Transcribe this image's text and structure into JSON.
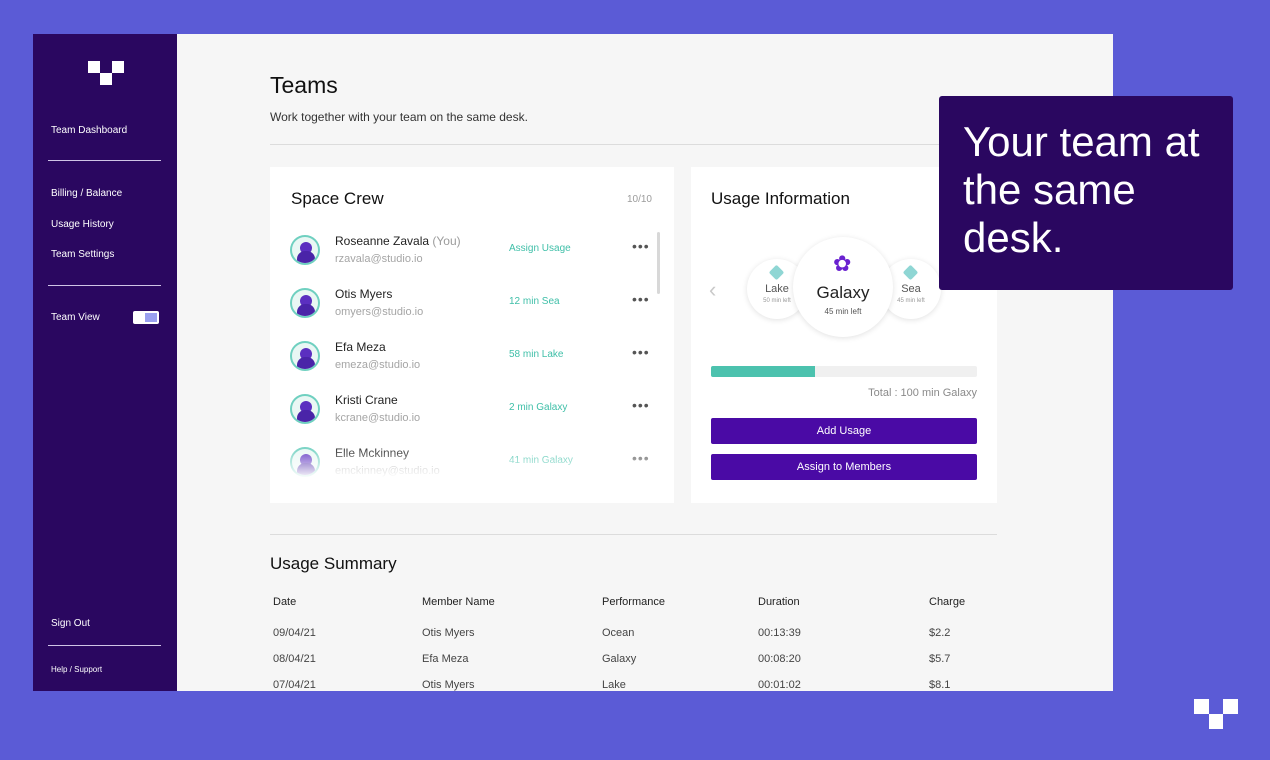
{
  "sidebar": {
    "logo_icon": "brand-logo-icon",
    "nav": {
      "team_dashboard": "Team Dashboard",
      "billing": "Billing / Balance",
      "usage_history": "Usage History",
      "team_settings": "Team Settings",
      "team_view": "Team View",
      "sign_out": "Sign Out",
      "help": "Help / Support"
    },
    "team_view_on": true
  },
  "header": {
    "title": "Teams",
    "subtitle": "Work together with your team on the same desk."
  },
  "crew": {
    "title": "Space Crew",
    "count": "10/10",
    "members": [
      {
        "name": "Roseanne Zavala",
        "tag": "(You)",
        "email": "rzavala@studio.io",
        "usage": "Assign Usage"
      },
      {
        "name": "Otis Myers",
        "tag": "",
        "email": "omyers@studio.io",
        "usage": "12 min Sea"
      },
      {
        "name": "Efa Meza",
        "tag": "",
        "email": "emeza@studio.io",
        "usage": "58 min Lake"
      },
      {
        "name": "Kristi Crane",
        "tag": "",
        "email": "kcrane@studio.io",
        "usage": "2 min Galaxy"
      },
      {
        "name": "Elle Mckinney",
        "tag": "",
        "email": "emckinney@studio.io",
        "usage": "41 min Galaxy"
      }
    ],
    "more_glyph": "•••"
  },
  "usage": {
    "title": "Usage Information",
    "options": [
      {
        "label": "Lake",
        "time": "50 min left"
      },
      {
        "label": "Galaxy",
        "time": "45 min left"
      },
      {
        "label": "Sea",
        "time": "45 min left"
      }
    ],
    "progress": 0.39,
    "total": "Total : 100 min Galaxy",
    "add_button": "Add Usage",
    "assign_button": "Assign to Members",
    "prev_glyph": "‹",
    "next_glyph": "›",
    "flower_glyph": "✿"
  },
  "overlay": {
    "text": "Your team at the same desk."
  },
  "summary": {
    "title": "Usage Summary",
    "columns": [
      "Date",
      "Member Name",
      "Performance",
      "Duration",
      "Charge"
    ],
    "rows": [
      [
        "09/04/21",
        "Otis Myers",
        "Ocean",
        "00:13:39",
        "$2.2"
      ],
      [
        "08/04/21",
        "Efa Meza",
        "Galaxy",
        "00:08:20",
        "$5.7"
      ],
      [
        "07/04/21",
        "Otis Myers",
        "Lake",
        "00:01:02",
        "$8.1"
      ]
    ]
  },
  "colors": {
    "background": "#5b5bd6",
    "sidebar": "#2a0760",
    "accent_button": "#4a0aa5",
    "teal": "#4cc2ae"
  }
}
